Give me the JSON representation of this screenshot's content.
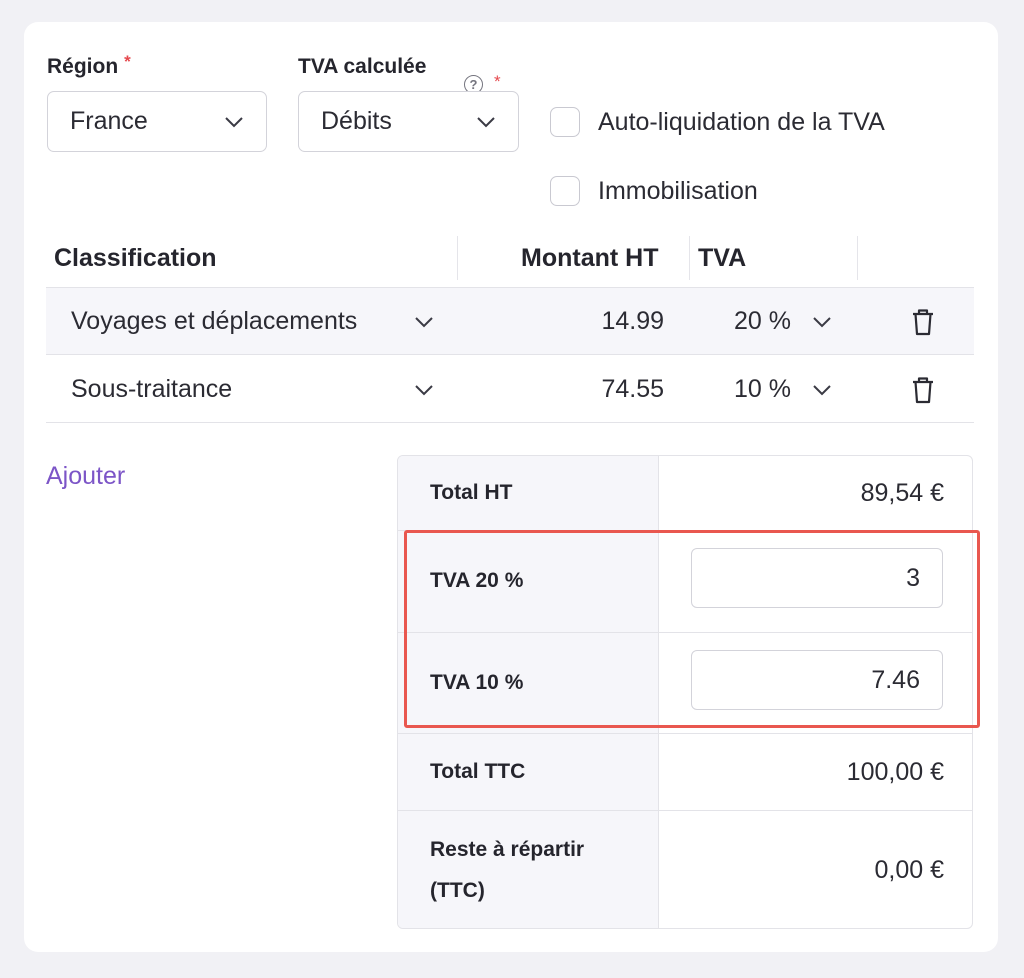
{
  "form": {
    "region": {
      "label": "Région",
      "required_mark": "*",
      "value": "France"
    },
    "tva_calculee": {
      "label": "TVA calculée",
      "help_icon": "question-circle-icon",
      "required_mark": "*",
      "value": "Débits"
    },
    "checkboxes": [
      {
        "label": "Auto-liquidation de la TVA",
        "checked": false
      },
      {
        "label": "Immobilisation",
        "checked": false
      }
    ]
  },
  "table": {
    "headers": {
      "classification": "Classification",
      "montant_ht": "Montant HT",
      "tva": "TVA"
    },
    "rows": [
      {
        "classification": "Voyages et déplacements",
        "montant": "14.99",
        "tva": "20 %"
      },
      {
        "classification": "Sous-traitance",
        "montant": "74.55",
        "tva": "10 %"
      }
    ]
  },
  "add_link": "Ajouter",
  "totals": {
    "total_ht": {
      "label": "Total HT",
      "value": "89,54 €"
    },
    "tva_20": {
      "label": "TVA 20 %",
      "value": "3"
    },
    "tva_10": {
      "label": "TVA 10 %",
      "value": "7.46"
    },
    "total_ttc": {
      "label": "Total TTC",
      "value": "100,00 €"
    },
    "reste": {
      "label_line1": "Reste à répartir",
      "label_line2": "(TTC)",
      "value": "0,00 €"
    }
  },
  "colors": {
    "accent_link": "#7c55c7",
    "highlight": "#e9574f",
    "required": "#e5484d"
  }
}
